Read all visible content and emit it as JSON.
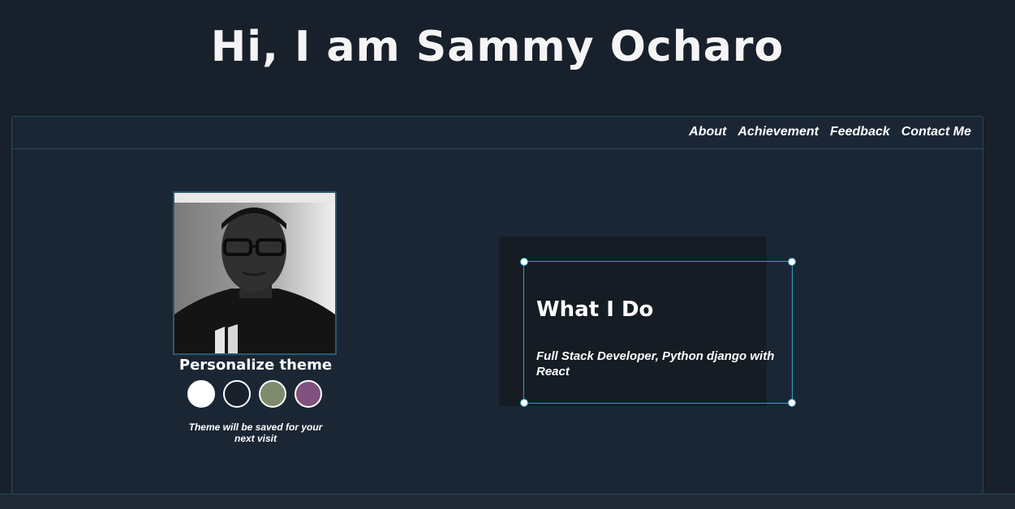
{
  "header": {
    "title": "Hi, I am Sammy Ocharo"
  },
  "nav": {
    "items": [
      {
        "label": "About"
      },
      {
        "label": "Achievement"
      },
      {
        "label": "Feedback"
      },
      {
        "label": "Contact Me"
      }
    ]
  },
  "profile": {
    "photo_alt": "Profile photo",
    "theme_title": "Personalize theme",
    "theme_options": [
      {
        "name": "white",
        "color": "#ffffff"
      },
      {
        "name": "dark",
        "color": "#17202b"
      },
      {
        "name": "green",
        "color": "#7e8c6d"
      },
      {
        "name": "purple",
        "color": "#80507e"
      }
    ],
    "theme_note": "Theme will be saved for your next visit"
  },
  "card": {
    "title": "What I Do",
    "text": "Full Stack Developer, Python django with React"
  }
}
